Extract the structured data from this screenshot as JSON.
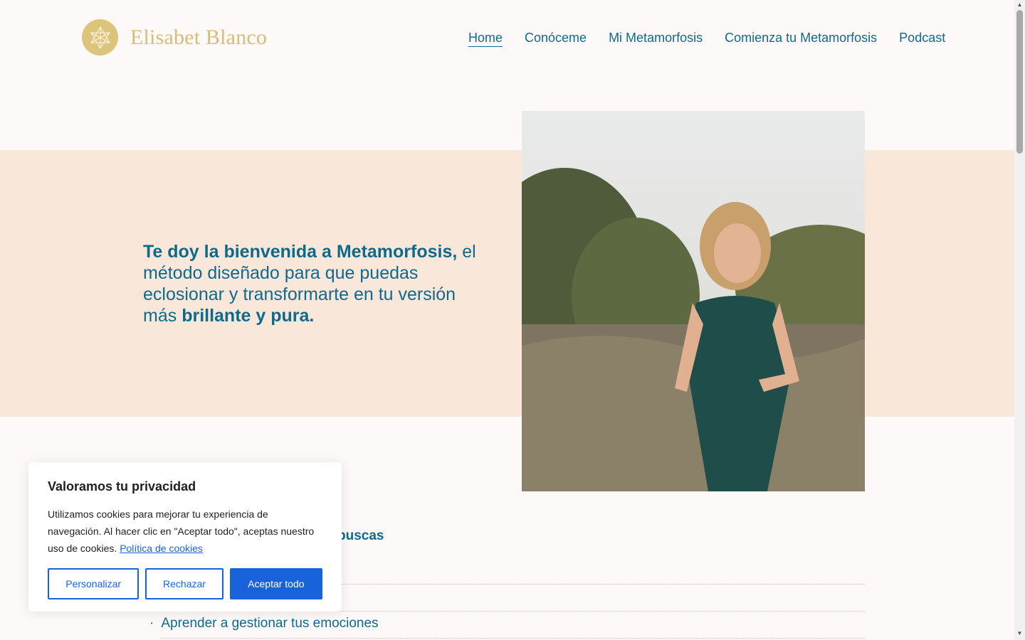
{
  "header": {
    "logo_text": "Elisabet Blanco",
    "nav": [
      {
        "label": "Home",
        "active": true
      },
      {
        "label": "Conóceme"
      },
      {
        "label": "Mi Metamorfosis"
      },
      {
        "label": "Comienza tu Metamorfosis"
      },
      {
        "label": "Podcast"
      }
    ]
  },
  "hero": {
    "bold_intro": "Te doy la bienvenida a Metamorfosis,",
    "text_mid": "el método diseñado para que puedas eclosionar y transformarte en tu versión más",
    "bold_end": "brillante y pura."
  },
  "content": {
    "partial_heading": "buscas",
    "list_item": "Aprender a gestionar tus emociones"
  },
  "cookie": {
    "title": "Valoramos tu privacidad",
    "text": "Utilizamos cookies para mejorar tu experiencia de navegación. Al hacer clic en \"Aceptar todo\", aceptas nuestro uso de cookies.",
    "link": "Política de cookies",
    "buttons": {
      "customize": "Personalizar",
      "reject": "Rechazar",
      "accept": "Aceptar todo"
    }
  },
  "colors": {
    "brand_blue": "#0e6a8c",
    "gold": "#d6bd78",
    "hero_bg": "#f9e8da",
    "cookie_blue": "#1863dc"
  }
}
